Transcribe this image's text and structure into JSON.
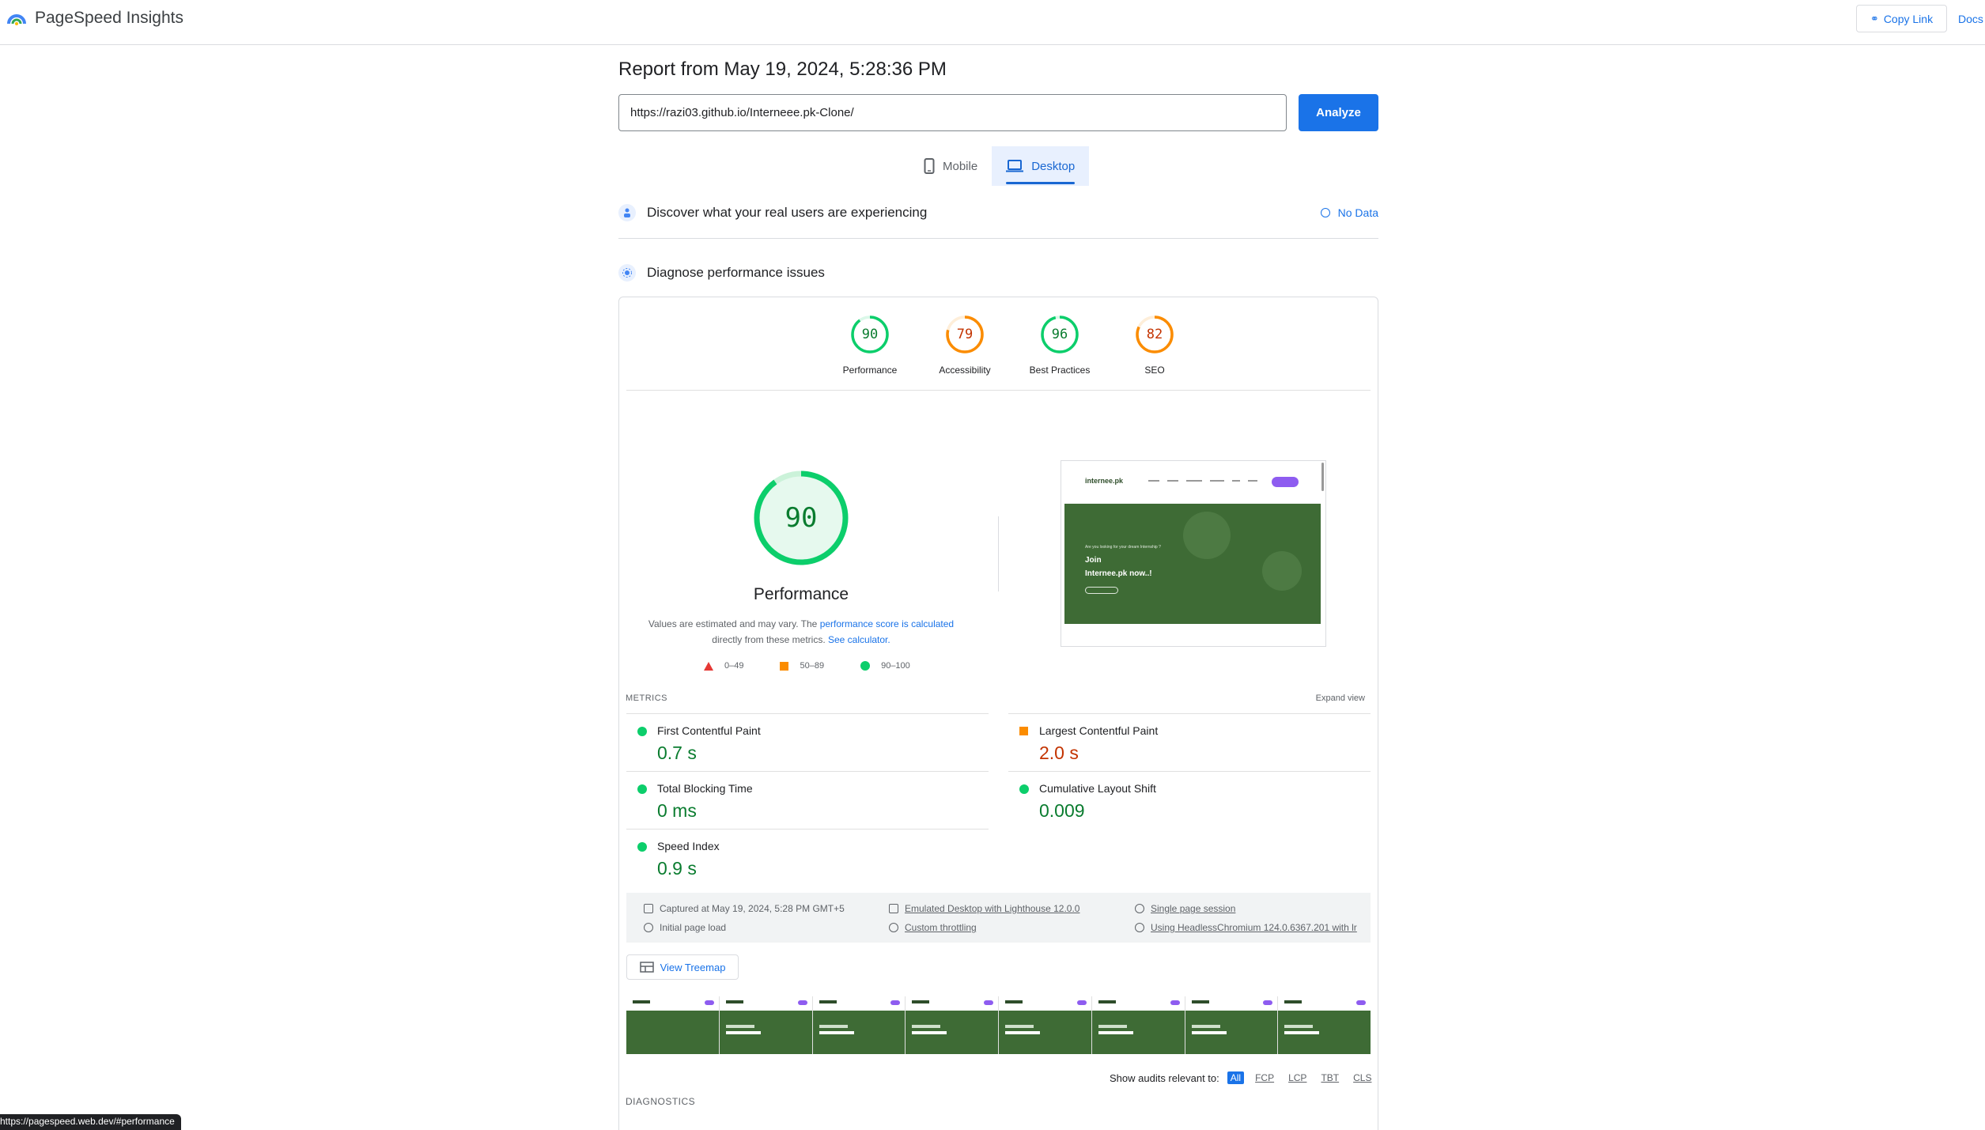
{
  "header": {
    "app_name": "PageSpeed Insights",
    "copy_link_label": "Copy Link",
    "docs_label": "Docs"
  },
  "report": {
    "title": "Report from May 19, 2024, 5:28:36 PM",
    "url_value": "https://razi03.github.io/Interneee.pk-Clone/",
    "analyze_label": "Analyze",
    "device_tabs": [
      {
        "label": "Mobile",
        "icon": "phone-icon",
        "active": false
      },
      {
        "label": "Desktop",
        "icon": "laptop-icon",
        "active": true
      }
    ]
  },
  "sections": {
    "discover_label": "Discover what your real users are experiencing",
    "no_data_label": "No Data",
    "diagnose_label": "Diagnose performance issues"
  },
  "scores": [
    {
      "label": "Performance",
      "value": 90,
      "color": "#0cce6b",
      "text_color": "#0a7c2f"
    },
    {
      "label": "Accessibility",
      "value": 79,
      "color": "#fb8c00",
      "text_color": "#c33300"
    },
    {
      "label": "Best Practices",
      "value": 96,
      "color": "#0cce6b",
      "text_color": "#0a7c2f"
    },
    {
      "label": "SEO",
      "value": 82,
      "color": "#fb8c00",
      "text_color": "#c33300"
    }
  ],
  "performance": {
    "score": "90",
    "title": "Performance",
    "note_prefix": "Values are estimated and may vary. The",
    "note_link": "performance score is calculated",
    "note_middle": "directly from these metrics.",
    "note_link2": "See calculator.",
    "legend": [
      {
        "range": "0–49",
        "shape": "triangle",
        "color": "#e53935"
      },
      {
        "range": "50–89",
        "shape": "square",
        "color": "#fb8c00"
      },
      {
        "range": "90–100",
        "shape": "circle",
        "color": "#0cce6b"
      }
    ]
  },
  "screenshot": {
    "logo": "internee.pk",
    "hero_small": "Are you looking for your dream Internship ?",
    "hero_line1": "Join",
    "hero_line2": "Internee.pk now..!"
  },
  "metrics": {
    "heading": "METRICS",
    "expand_label": "Expand view",
    "items": [
      {
        "label": "First Contentful Paint",
        "value": "0.7 s",
        "status": "good"
      },
      {
        "label": "Largest Contentful Paint",
        "value": "2.0 s",
        "status": "average"
      },
      {
        "label": "Total Blocking Time",
        "value": "0 ms",
        "status": "good"
      },
      {
        "label": "Cumulative Layout Shift",
        "value": "0.009",
        "status": "good"
      },
      {
        "label": "Speed Index",
        "value": "0.9 s",
        "status": "good"
      }
    ]
  },
  "run_info": {
    "captured": "Captured at May 19, 2024, 5:28 PM GMT+5",
    "load": "Initial page load",
    "device": "Emulated Desktop with Lighthouse 12.0.0",
    "throttling": "Custom throttling",
    "session": "Single page session",
    "browser": "Using HeadlessChromium 124.0.6367.201 with lr"
  },
  "treemap_label": "View Treemap",
  "audit_filter": {
    "label": "Show audits relevant to:",
    "chips": [
      "All",
      "FCP",
      "LCP",
      "TBT",
      "CLS"
    ]
  },
  "diagnostics_heading": "DIAGNOSTICS",
  "status_bar_url": "https://pagespeed.web.dev/#performance"
}
